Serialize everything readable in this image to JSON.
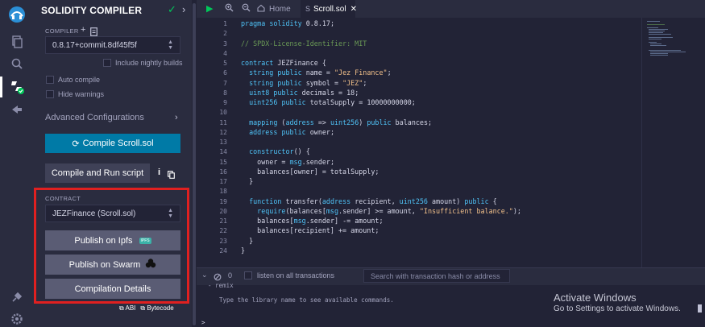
{
  "sidebar_panel": {
    "title": "SOLIDITY COMPILER",
    "compiler_label": "COMPILER",
    "compiler_version": "0.8.17+commit.8df45f5f",
    "include_nightly": "Include nightly builds",
    "auto_compile": "Auto compile",
    "hide_warnings": "Hide warnings",
    "advanced": "Advanced Configurations",
    "compile_button": "Compile Scroll.sol",
    "compile_run_button": "Compile and Run script",
    "contract_label": "CONTRACT",
    "contract_selected": "JEZFinance (Scroll.sol)",
    "publish_ipfs": "Publish on Ipfs",
    "ipfs_badge": "IPFS",
    "publish_swarm": "Publish on Swarm",
    "compilation_details": "Compilation Details",
    "abi_link": "ABI",
    "bytecode_link": "Bytecode"
  },
  "tabs": {
    "home": "Home",
    "active_file": "Scroll.sol"
  },
  "editor": {
    "line_numbers": [
      "1",
      "2",
      "3",
      "4",
      "5",
      "6",
      "7",
      "8",
      "9",
      "10",
      "11",
      "12",
      "13",
      "14",
      "15",
      "16",
      "17",
      "18",
      "19",
      "20",
      "21",
      "22",
      "23",
      "24"
    ],
    "lines": [
      "pragma solidity 0.8.17;",
      "",
      "// SPDX-License-Identifier: MIT",
      "",
      "contract JEZFinance {",
      "  string public name = \"Jez Finance\";",
      "  string public symbol = \"JEZ\";",
      "  uint8 public decimals = 18;",
      "  uint256 public totalSupply = 10000000000;",
      "",
      "  mapping (address => uint256) public balances;",
      "  address public owner;",
      "",
      "  constructor() {",
      "    owner = msg.sender;",
      "    balances[owner] = totalSupply;",
      "  }",
      "",
      "  function transfer(address recipient, uint256 amount) public {",
      "    require(balances[msg.sender] >= amount, \"Insufficient balance.\");",
      "    balances[msg.sender] -= amount;",
      "    balances[recipient] += amount;",
      "  }",
      "}"
    ]
  },
  "terminal": {
    "count": "0",
    "listen_label": "listen on all transactions",
    "search_placeholder": "Search with transaction hash or address",
    "line1": "- remix",
    "line2": "Type the library name to see available commands.",
    "prompt": ">"
  },
  "windows_watermark": {
    "title": "Activate Windows",
    "subtitle": "Go to Settings to activate Windows."
  },
  "colors": {
    "compile_button": "#007aa6",
    "highlight_box": "#e02020",
    "success_check": "#00c85a"
  }
}
